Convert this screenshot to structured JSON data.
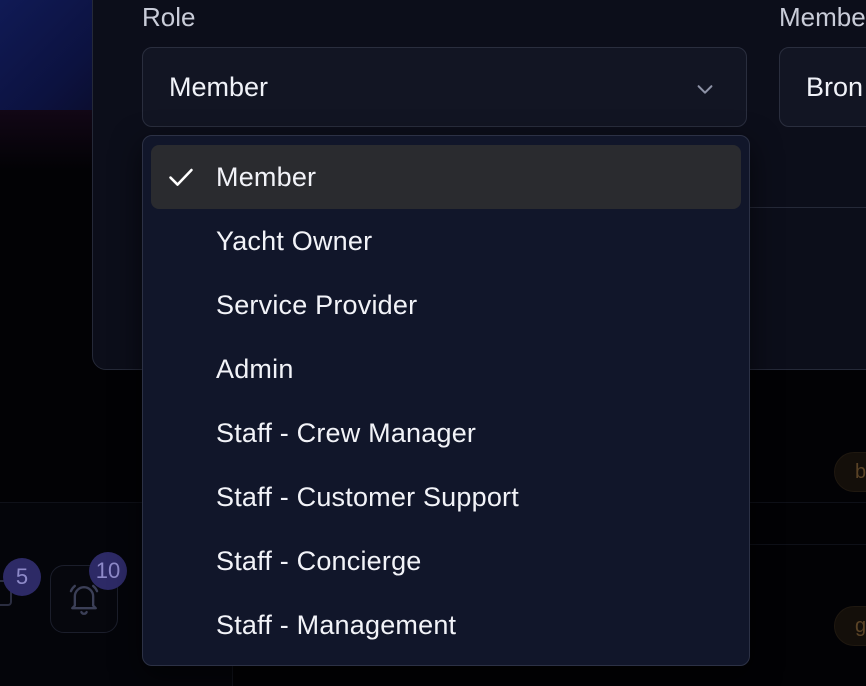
{
  "form": {
    "role": {
      "label": "Role",
      "value": "Member"
    },
    "membership": {
      "label": "Membe",
      "value": "Bron"
    }
  },
  "role_options": [
    {
      "label": "Member",
      "selected": true
    },
    {
      "label": "Yacht Owner",
      "selected": false
    },
    {
      "label": "Service Provider",
      "selected": false
    },
    {
      "label": "Admin",
      "selected": false
    },
    {
      "label": "Staff - Crew Manager",
      "selected": false
    },
    {
      "label": "Staff - Customer Support",
      "selected": false
    },
    {
      "label": "Staff - Concierge",
      "selected": false
    },
    {
      "label": "Staff - Management",
      "selected": false
    }
  ],
  "background": {
    "message_badge_count": "5",
    "notification_badge_count": "10",
    "pill_top_text": "b",
    "pill_bottom_text": "g"
  },
  "colors": {
    "dropdown_bg": "#11162a",
    "selected_option_bg": "#2a2b2f",
    "badge_bg": "#2d2a66"
  }
}
